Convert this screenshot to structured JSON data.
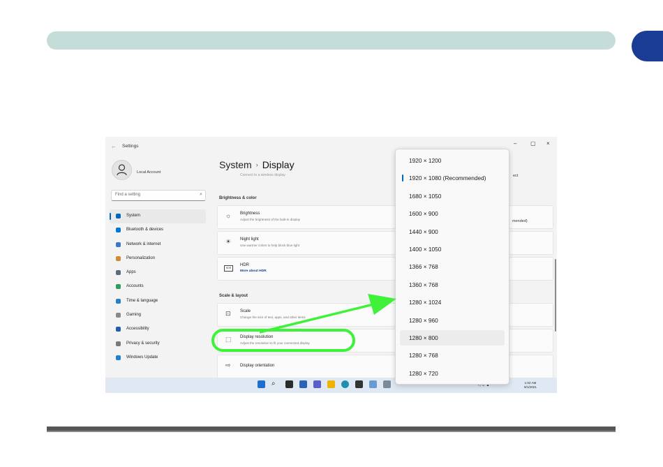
{
  "window": {
    "app_title": "Settings",
    "minimize": "–",
    "maximize": "▢",
    "close": "×"
  },
  "account": {
    "name": "Local Account"
  },
  "search": {
    "placeholder": "Find a setting"
  },
  "sidebar": {
    "items": [
      {
        "label": "System",
        "selected": true,
        "color": "#0067c0"
      },
      {
        "label": "Bluetooth & devices",
        "color": "#0078d4"
      },
      {
        "label": "Network & internet",
        "color": "#3a78c8"
      },
      {
        "label": "Personalization",
        "color": "#d08a3a"
      },
      {
        "label": "Apps",
        "color": "#5b6b84"
      },
      {
        "label": "Accounts",
        "color": "#2f9e5a"
      },
      {
        "label": "Time & language",
        "color": "#2a7ec4"
      },
      {
        "label": "Gaming",
        "color": "#8a8a8a"
      },
      {
        "label": "Accessibility",
        "color": "#1f5fa8"
      },
      {
        "label": "Privacy & security",
        "color": "#7a7a7a"
      },
      {
        "label": "Windows Update",
        "color": "#1f7fd0"
      }
    ]
  },
  "page": {
    "breadcrumb_parent": "System",
    "breadcrumb_separator": "›",
    "breadcrumb_current": "Display",
    "wireless_fragment": "Connect to a wireless display"
  },
  "brightness_section": {
    "heading": "Brightness & color",
    "brightness_title": "Brightness",
    "brightness_sub": "Adjust the brightness of the built-in display",
    "night_title": "Night light",
    "night_sub": "Use warmer colors to help block blue light",
    "hdr_title": "HDR",
    "hdr_link": "More about HDR",
    "hdr_badge": "HDR"
  },
  "scale_section": {
    "heading": "Scale & layout",
    "scale_title": "Scale",
    "scale_sub": "Change the size of text, apps, and other items",
    "resolution_title": "Display resolution",
    "resolution_sub": "Adjust the resolution to fit your connected display",
    "orientation_title": "Display orientation"
  },
  "behind": {
    "detect_fragment": "ect",
    "recommended_fragment": "mended)"
  },
  "resolution_dropdown": {
    "options": [
      "1920 × 1200",
      "1920 × 1080 (Recommended)",
      "1680 × 1050",
      "1600 × 900",
      "1440 × 900",
      "1400 × 1050",
      "1366 × 768",
      "1360 × 768",
      "1280 × 1024",
      "1280 × 960",
      "1280 × 800",
      "1280 × 768",
      "1280 × 720"
    ],
    "selected": "1920 × 1080 (Recommended)",
    "hovered": "1280 × 800"
  },
  "taskbar": {
    "time": "1:02 AM",
    "date": "9/1/2021",
    "tray_text": "^ ◁ ☺ ▲"
  },
  "colors": {
    "header_bar": "#c5ddd9",
    "side_tab": "#1b3c94",
    "accent": "#0067c0",
    "annotation_green": "#3ef23a"
  }
}
